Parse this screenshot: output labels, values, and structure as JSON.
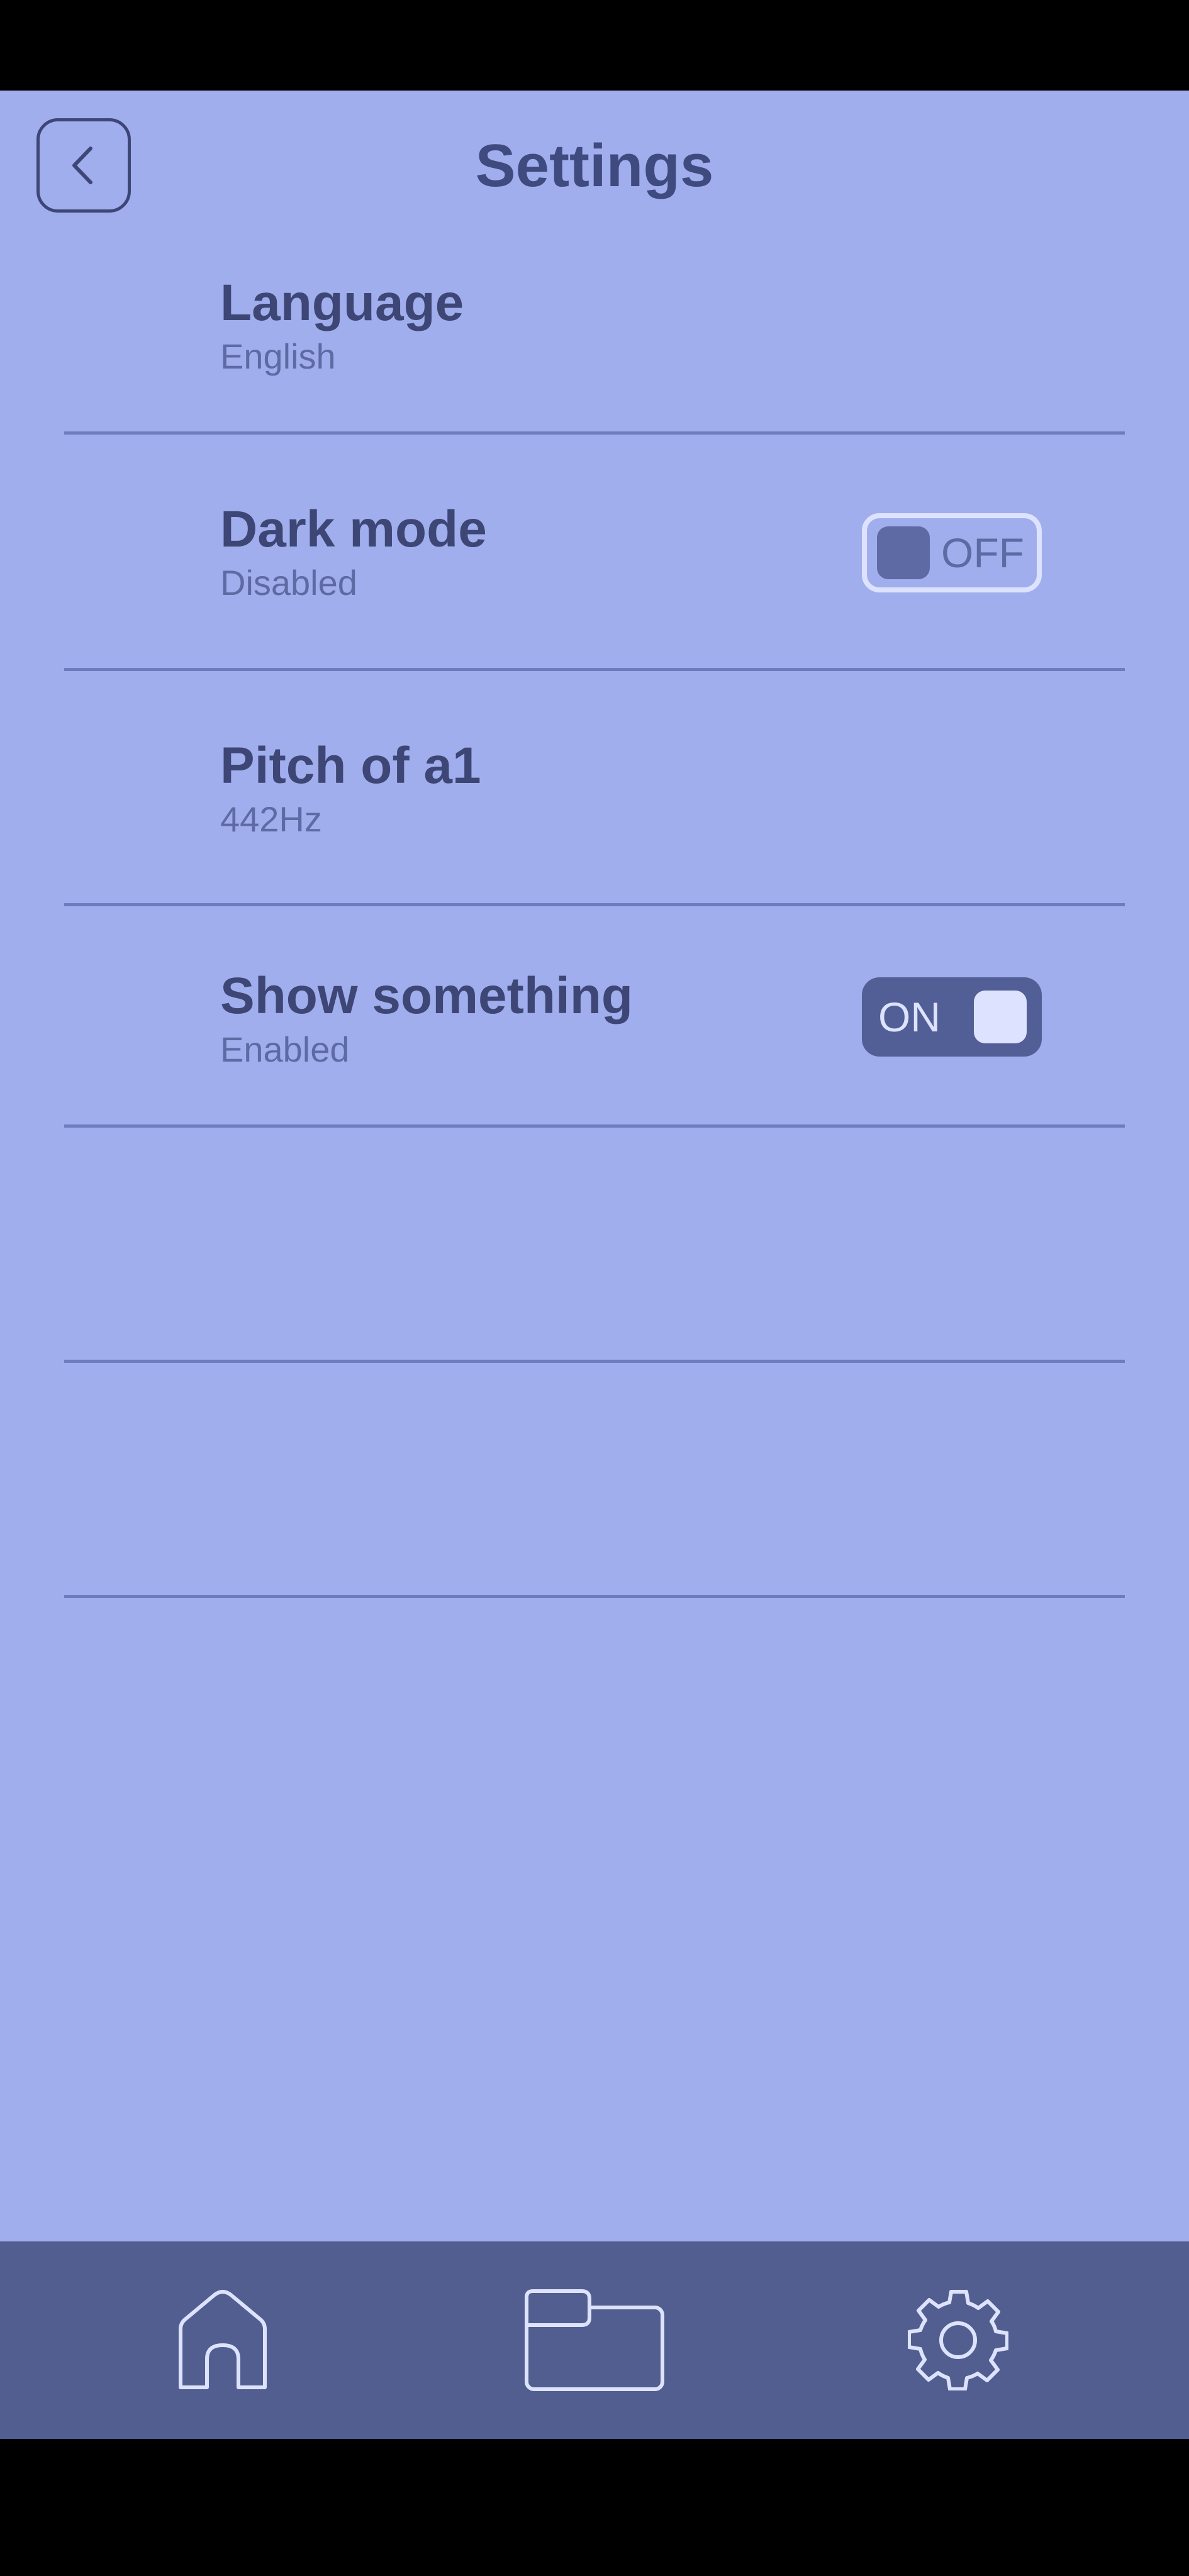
{
  "header": {
    "title": "Settings",
    "back_icon": "chevron-left-icon"
  },
  "settings": [
    {
      "title": "Language",
      "subtitle": "English"
    },
    {
      "title": "Dark mode",
      "subtitle": "Disabled",
      "toggle": {
        "state": "off",
        "label": "OFF"
      }
    },
    {
      "title": "Pitch of a1",
      "subtitle": "442Hz"
    },
    {
      "title": "Show something",
      "subtitle": "Enabled",
      "toggle": {
        "state": "on",
        "label": "ON"
      }
    }
  ],
  "bottom_nav": {
    "items": [
      {
        "icon": "home-icon"
      },
      {
        "icon": "folder-icon"
      },
      {
        "icon": "gear-icon"
      }
    ]
  },
  "colors": {
    "background": "#a0aeee",
    "text_primary": "#3d4675",
    "text_secondary": "#5e6aa3",
    "nav_background": "#525e8f",
    "toggle_light": "#dde3ff"
  }
}
